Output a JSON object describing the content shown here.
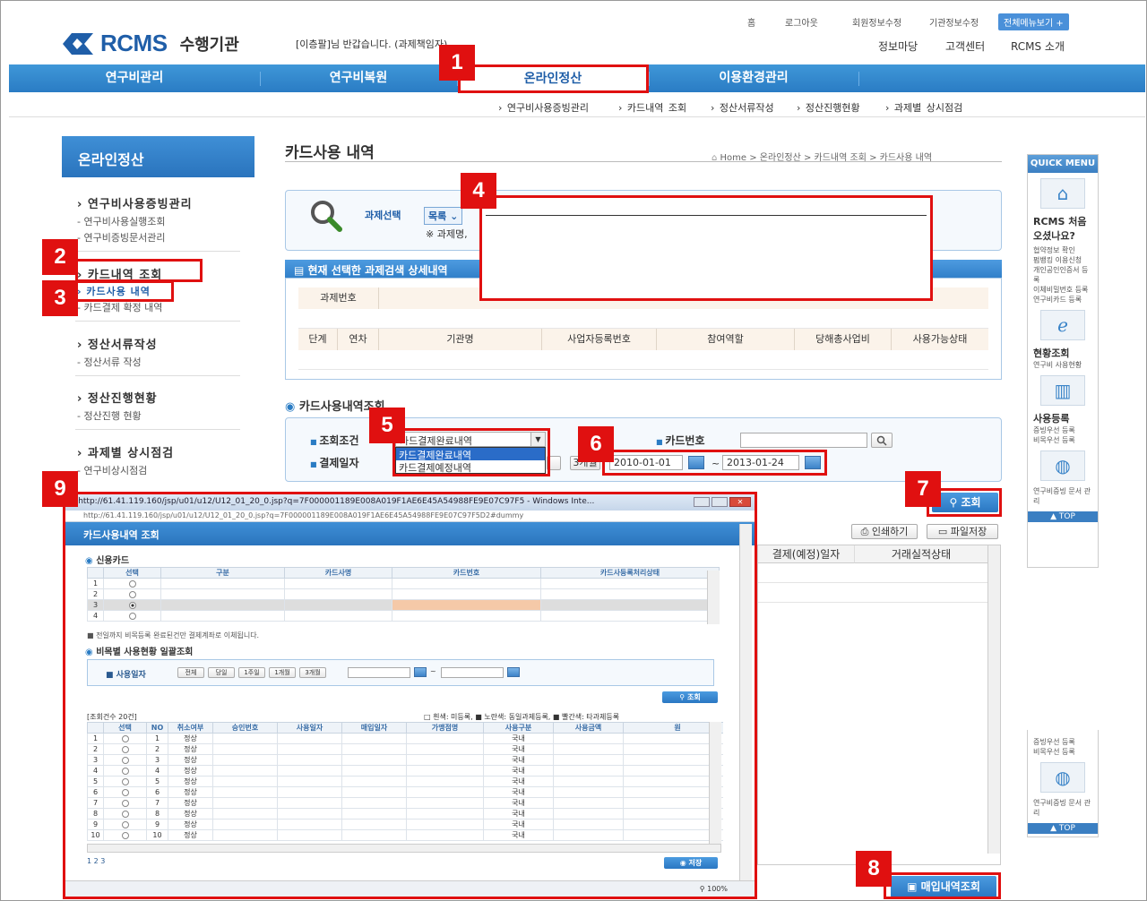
{
  "header": {
    "brand": "RCMS",
    "org": "수행기관",
    "welcome": "[이층팔]님 반갑습니다. (과제책임자)",
    "util_links": [
      "홈",
      "로그아웃",
      "회원정보수정",
      "기관정보수정"
    ],
    "all_menu": "전체메뉴보기 +",
    "secondary_links": [
      "정보마당",
      "고객센터",
      "RCMS 소개"
    ]
  },
  "gnb": {
    "items": [
      "연구비관리",
      "연구비복원",
      "온라인정산",
      "이용환경관리"
    ],
    "sub_items": [
      "› 연구비사용증빙관리",
      "› 카드내역 조회",
      "› 정산서류작성",
      "› 정산진행현황",
      "› 과제별 상시점검"
    ]
  },
  "lnb": {
    "title": "온라인정산",
    "groups": [
      {
        "title": "› 연구비사용증빙관리",
        "subs": [
          "- 연구비사용실행조회",
          "- 연구비증빙문서관리"
        ]
      },
      {
        "title": "› 카드내역 조회",
        "subs": [
          "› 카드사용 내역",
          "- 카드결제 확정 내역"
        ]
      },
      {
        "title": "› 정산서류작성",
        "subs": [
          "- 정산서류 작성"
        ]
      },
      {
        "title": "› 정산진행현황",
        "subs": [
          "- 정산진행 현황"
        ]
      },
      {
        "title": "› 과제별 상시점검",
        "subs": [
          "- 연구비상시점검"
        ]
      }
    ]
  },
  "page": {
    "title": "카드사용 내역",
    "breadcrumb": "Home  >  온라인정산  >  카드내역 조회  >  카드사용 내역",
    "select_label": "과제선택",
    "select_button": "목록",
    "select_note": "※ 과제명,",
    "panel_title": "현재 선택한 과제검색 상세내역",
    "panel_row1": [
      "과제번호"
    ],
    "panel_row2": [
      "단계",
      "연차",
      "기관명",
      "사업자등록번호",
      "참여역할",
      "당해총사업비",
      "사용가능상태"
    ],
    "section_title": "카드사용내역조회",
    "cond_label": "조회조건",
    "cond_value": "카드결제완료내역",
    "cond_options": [
      "카드결제완료내역",
      "카드결제예정내역"
    ],
    "date_label": "결제일자",
    "quick_btn": "3개월",
    "date_from": "2010-01-01",
    "date_to": "2013-01-24",
    "date_sep": "~",
    "cardno_label": "카드번호",
    "search_btn": "조회",
    "print_btn": "인쇄하기",
    "save_btn": "파일저장",
    "result_headers": [
      "결제(예정)일자",
      "거래실적상태"
    ],
    "purchase_btn": "매입내역조회"
  },
  "quick": {
    "head": "QUICK MENU",
    "items": [
      {
        "title": "RCMS 처음 오셨나요?",
        "desc": "협약정보 확인\n펌뱅킹 이용신청\n개인공인인증서 등록\n이체비밀번호 등록\n연구비카드 등록"
      },
      {
        "title": "현황조회",
        "desc": "연구비 사용현황"
      },
      {
        "title": "사용등록",
        "desc": "증빙우선 등록\n비목우선 등록"
      },
      {
        "title": "",
        "desc": "연구비증빙 문서 관리"
      }
    ],
    "top": "▲ TOP",
    "lower_desc1": "증빙우선 등록\n비목우선 등록",
    "lower_desc2": "연구비증빙 문서 관리"
  },
  "popup": {
    "window_title": "http://61.41.119.160/jsp/u01/u12/U12_01_20_0.jsp?q=7F000001189E008A019F1AE6E45A54988FE9E07C97F5 - Windows Inte...",
    "address": "http://61.41.119.160/jsp/u01/u12/U12_01_20_0.jsp?q=7F000001189E008A019F1AE6E45A54988FE9E07C97F5D2#dummy",
    "header": "카드사용내역 조회",
    "credit_title": "신용카드",
    "card_headers": [
      "선택",
      "구분",
      "카드사명",
      "카드번호",
      "카드사등록처리상태"
    ],
    "card_rows": [
      "1",
      "2",
      "3",
      "4"
    ],
    "note": "■ 전일까지 비목등록 완료된건만 결제계좌로 이체됩니다.",
    "bulk_title": "비목별 사용현황 일괄조회",
    "use_date_label": "■ 사용일자",
    "range_btns": [
      "전체",
      "당일",
      "1주일",
      "1개월",
      "3개월"
    ],
    "search_btn": "조회",
    "count_text": "[조회건수 20건]",
    "legend": "□ 흰색: 미등록, ■ 노란색: 동일과제등록, ■ 빨간색: 타과제등록",
    "list_headers": [
      "선택",
      "NO",
      "취소여부",
      "승인번호",
      "사용일자",
      "매입일자",
      "가맹점명",
      "사용구분",
      "사용금액",
      "원"
    ],
    "list_rows": [
      {
        "no": "1",
        "status": "정상",
        "kind": "국내"
      },
      {
        "no": "2",
        "status": "정상",
        "kind": "국내"
      },
      {
        "no": "3",
        "status": "정상",
        "kind": "국내"
      },
      {
        "no": "4",
        "status": "정상",
        "kind": "국내"
      },
      {
        "no": "5",
        "status": "정상",
        "kind": "국내"
      },
      {
        "no": "6",
        "status": "정상",
        "kind": "국내"
      },
      {
        "no": "7",
        "status": "정상",
        "kind": "국내"
      },
      {
        "no": "8",
        "status": "정상",
        "kind": "국내"
      },
      {
        "no": "9",
        "status": "정상",
        "kind": "국내"
      },
      {
        "no": "10",
        "status": "정상",
        "kind": "국내"
      }
    ],
    "pages": "1  2  3",
    "save_btn": "저장",
    "zoom": "100%"
  },
  "callouts": [
    "1",
    "2",
    "3",
    "4",
    "5",
    "6",
    "7",
    "8",
    "9"
  ],
  "colors": {
    "accent": "#2a7cc4",
    "callout": "#e01010",
    "thead_bg": "#fbf3ea"
  }
}
